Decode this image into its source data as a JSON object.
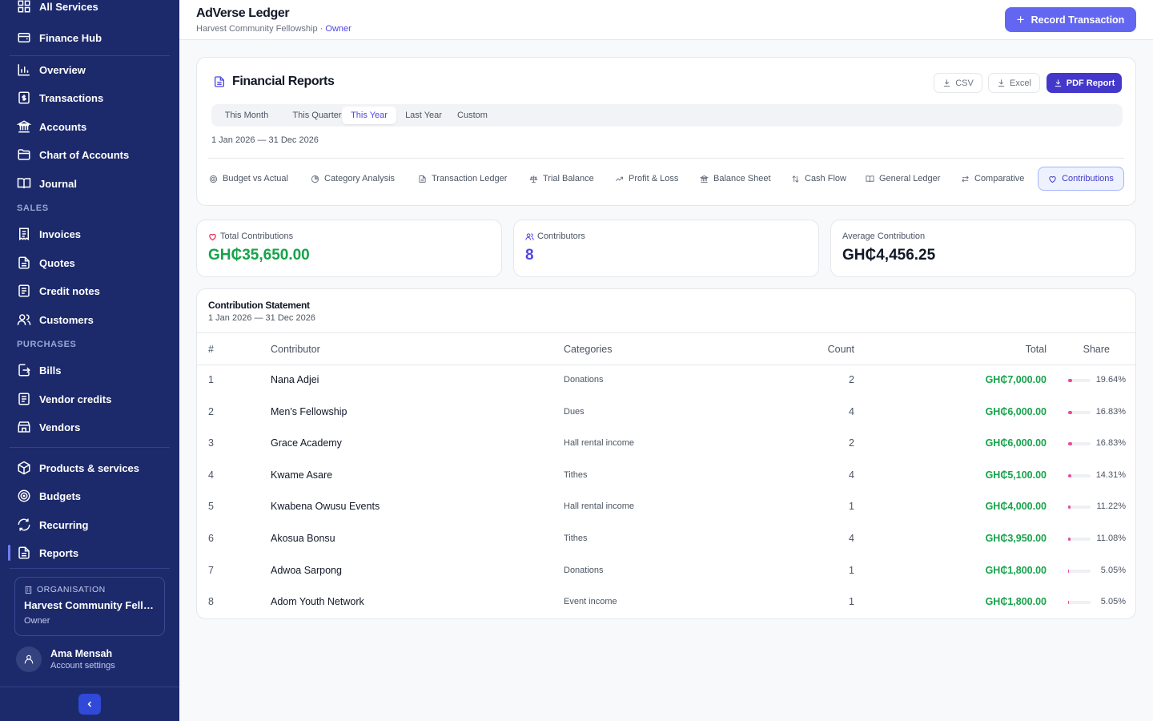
{
  "sidebar": {
    "items": [
      {
        "label": "All Services",
        "icon": "grid-icon"
      },
      {
        "label": "Finance Hub",
        "icon": "wallet-icon"
      },
      {
        "label": "Overview",
        "icon": "bar-chart-icon"
      },
      {
        "label": "Transactions",
        "icon": "dollar-receipt-icon"
      },
      {
        "label": "Accounts",
        "icon": "bank-icon"
      },
      {
        "label": "Chart of Accounts",
        "icon": "folder-icon"
      },
      {
        "label": "Journal",
        "icon": "book-open-icon"
      },
      {
        "label": "Invoices",
        "icon": "receipt-icon"
      },
      {
        "label": "Quotes",
        "icon": "document-icon"
      },
      {
        "label": "Credit notes",
        "icon": "document-lines-icon"
      },
      {
        "label": "Customers",
        "icon": "users-icon"
      },
      {
        "label": "Bills",
        "icon": "bill-in-icon"
      },
      {
        "label": "Vendor credits",
        "icon": "document-lines-icon"
      },
      {
        "label": "Vendors",
        "icon": "store-icon"
      },
      {
        "label": "Products & services",
        "icon": "package-icon"
      },
      {
        "label": "Budgets",
        "icon": "target-icon"
      },
      {
        "label": "Recurring",
        "icon": "refresh-icon"
      },
      {
        "label": "Reports",
        "icon": "report-icon"
      }
    ],
    "sections": {
      "sales": "SALES",
      "purchases": "PURCHASES"
    },
    "org": {
      "kicker": "ORGANISATION",
      "name": "Harvest Community Fello...",
      "role": "Owner"
    },
    "user": {
      "name": "Ama Mensah",
      "subtitle": "Account settings"
    }
  },
  "header": {
    "title": "AdVerse Ledger",
    "org": "Harvest Community Fellowship",
    "separator": " · ",
    "role": "Owner",
    "record_button": "Record Transaction"
  },
  "reports": {
    "title": "Financial Reports",
    "exports": {
      "csv": "CSV",
      "excel": "Excel",
      "pdf": "PDF Report"
    },
    "periods": [
      "This Month",
      "This Quarter",
      "This Year",
      "Last Year",
      "Custom"
    ],
    "selected_period": "This Year",
    "date_range": "1 Jan 2026 — 31 Dec 2026",
    "report_tabs": [
      {
        "label": "Budget vs Actual",
        "icon": "target-icon"
      },
      {
        "label": "Category Analysis",
        "icon": "pie-chart-icon"
      },
      {
        "label": "Transaction Ledger",
        "icon": "document-icon"
      },
      {
        "label": "Trial Balance",
        "icon": "scale-icon"
      },
      {
        "label": "Profit & Loss",
        "icon": "trending-up-icon"
      },
      {
        "label": "Balance Sheet",
        "icon": "bank-icon"
      },
      {
        "label": "Cash Flow",
        "icon": "arrows-updown-icon"
      },
      {
        "label": "General Ledger",
        "icon": "book-open-icon"
      },
      {
        "label": "Comparative",
        "icon": "swap-icon"
      },
      {
        "label": "Contributions",
        "icon": "heart-icon"
      }
    ],
    "selected_tab": "Contributions"
  },
  "stats": {
    "total": {
      "label": "Total Contributions",
      "value": "GH₵35,650.00",
      "icon": "heart-icon"
    },
    "contributors": {
      "label": "Contributors",
      "value": "8",
      "icon": "users-icon"
    },
    "average": {
      "label": "Average Contribution",
      "value": "GH₵4,456.25"
    }
  },
  "statement": {
    "title": "Contribution Statement",
    "date_range": "1 Jan 2026 — 31 Dec 2026",
    "columns": [
      "#",
      "Contributor",
      "Categories",
      "Count",
      "Total",
      "Share"
    ],
    "rows": [
      {
        "num": "1",
        "name": "Nana Adjei",
        "category": "Donations",
        "count": "2",
        "total": "GH₵7,000.00",
        "share": "19.64%",
        "share_value": 19.64
      },
      {
        "num": "2",
        "name": "Men's Fellowship",
        "category": "Dues",
        "count": "4",
        "total": "GH₵6,000.00",
        "share": "16.83%",
        "share_value": 16.83
      },
      {
        "num": "3",
        "name": "Grace Academy",
        "category": "Hall rental income",
        "count": "2",
        "total": "GH₵6,000.00",
        "share": "16.83%",
        "share_value": 16.83
      },
      {
        "num": "4",
        "name": "Kwame Asare",
        "category": "Tithes",
        "count": "4",
        "total": "GH₵5,100.00",
        "share": "14.31%",
        "share_value": 14.31
      },
      {
        "num": "5",
        "name": "Kwabena Owusu Events",
        "category": "Hall rental income",
        "count": "1",
        "total": "GH₵4,000.00",
        "share": "11.22%",
        "share_value": 11.22
      },
      {
        "num": "6",
        "name": "Akosua Bonsu",
        "category": "Tithes",
        "count": "4",
        "total": "GH₵3,950.00",
        "share": "11.08%",
        "share_value": 11.08
      },
      {
        "num": "7",
        "name": "Adwoa Sarpong",
        "category": "Donations",
        "count": "1",
        "total": "GH₵1,800.00",
        "share": "5.05%",
        "share_value": 5.05
      },
      {
        "num": "8",
        "name": "Adom Youth Network",
        "category": "Event income",
        "count": "1",
        "total": "GH₵1,800.00",
        "share": "5.05%",
        "share_value": 5.05
      }
    ]
  },
  "colors": {
    "sidebar": "#1c2a6b",
    "accent": "#4338ca",
    "primary_button": "#6366f1",
    "money": "#16a34a",
    "share_bar": "#ec4899",
    "contributors": "#4f46e5"
  }
}
